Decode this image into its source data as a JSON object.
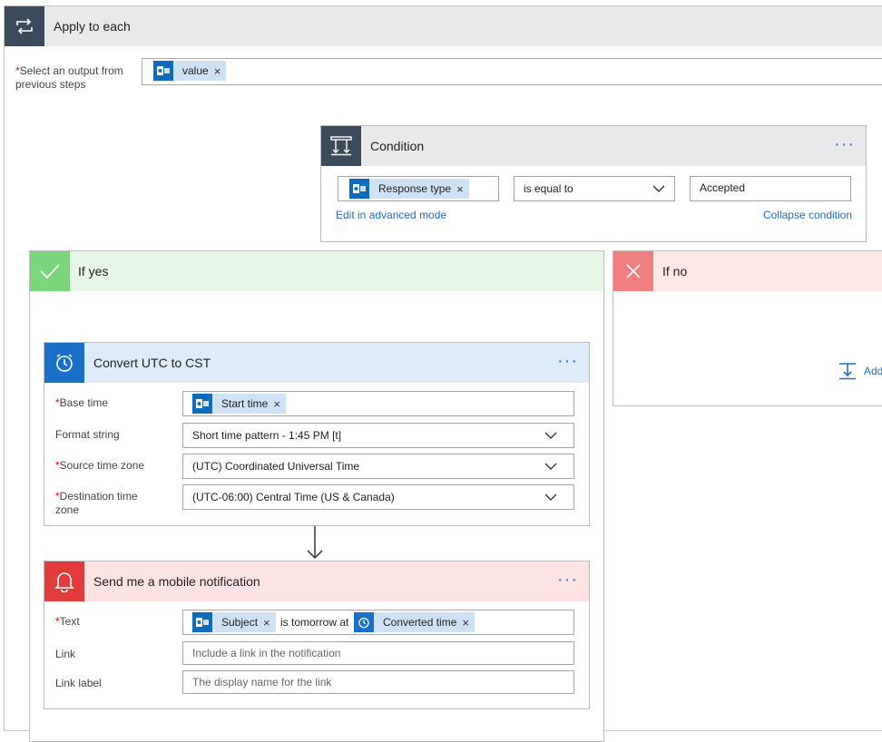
{
  "colors": {
    "loop_header": "#e9e9ec",
    "loop_icon": "#3c4b5c",
    "condition_icon": "#3c4b5c",
    "yes_header": "#e8f6e7",
    "yes_icon": "#7bd67b",
    "no_header": "#fde7e7",
    "no_icon": "#f07f7f",
    "convert_header": "#deebfa",
    "convert_icon": "#1a6fc9",
    "notify_header": "#fde3e3",
    "notify_icon": "#e13b3b",
    "token_bg": "#cfe1f5",
    "link": "#1a6fc9"
  },
  "apply": {
    "title": "Apply to each",
    "icon": "loop-icon",
    "select_label_req": "*",
    "select_label": "Select an output from previous steps",
    "token": {
      "label": "value",
      "icon": "outlook-icon"
    }
  },
  "condition": {
    "title": "Condition",
    "icon": "condition-icon",
    "more": "···",
    "left_token": {
      "label": "Response type",
      "icon": "outlook-icon"
    },
    "operator": "is equal to",
    "value": "Accepted",
    "edit_link": "Edit in advanced mode",
    "collapse_link": "Collapse condition"
  },
  "if_yes": {
    "title": "If yes",
    "icon": "check-icon"
  },
  "if_no": {
    "title": "If no",
    "icon": "close-icon",
    "add_label": "Add"
  },
  "convert": {
    "title": "Convert UTC to CST",
    "icon": "alarm-clock-icon",
    "more": "···",
    "base_time_label": "Base time",
    "base_time_token": "Start time",
    "format_label": "Format string",
    "format_value": "Short time pattern - 1:45 PM [t]",
    "source_label": "Source time zone",
    "source_value": "(UTC) Coordinated Universal Time",
    "dest_label": "Destination time zone",
    "dest_value": "(UTC-06:00) Central Time (US & Canada)",
    "required_mark": "*"
  },
  "notify": {
    "title": "Send me a mobile notification",
    "icon": "bell-icon",
    "more": "···",
    "text_label": "Text",
    "text_token1": "Subject",
    "text_middle": "is tomorrow at",
    "text_token2": "Converted time",
    "link_label": "Link",
    "link_placeholder": "Include a link in the notification",
    "link_label_label": "Link label",
    "link_label_placeholder": "The display name for the link",
    "required_mark": "*"
  }
}
